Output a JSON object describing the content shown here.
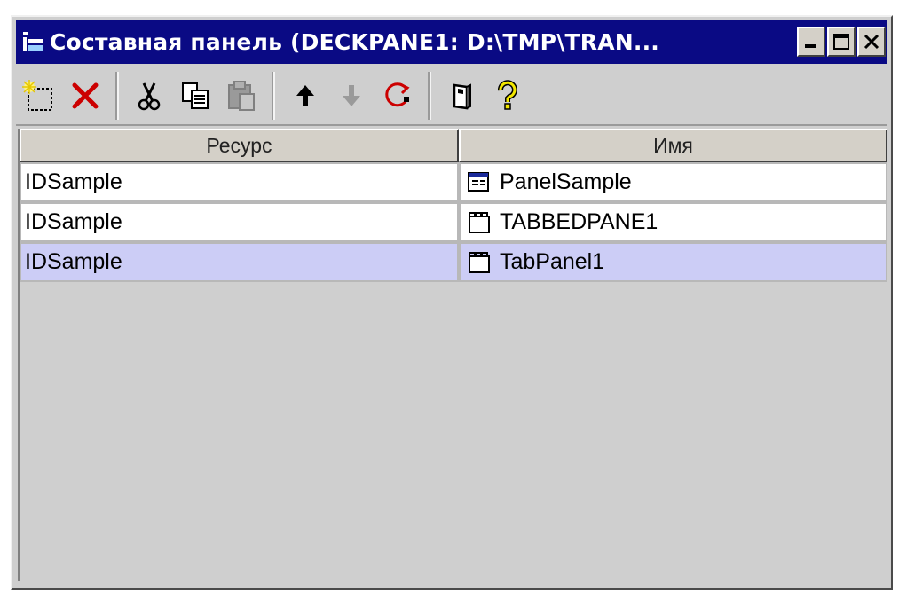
{
  "window": {
    "title": "Составная панель (DECKPANE1: D:\\TMP\\TRAN...",
    "icon": "panel-window-icon",
    "controls": [
      "minimize-icon",
      "maximize-icon",
      "close-icon"
    ]
  },
  "toolbar": {
    "buttons": [
      {
        "name": "new-icon"
      },
      {
        "name": "delete-icon",
        "color": "#cc0000"
      },
      {
        "name": "cut-icon"
      },
      {
        "name": "copy-icon"
      },
      {
        "name": "paste-icon",
        "disabled": true
      },
      {
        "name": "move-up-icon"
      },
      {
        "name": "move-down-icon",
        "disabled": true
      },
      {
        "name": "refresh-icon",
        "color": "#cc0000"
      },
      {
        "name": "properties-icon"
      },
      {
        "name": "help-icon",
        "color": "#e8d800"
      }
    ]
  },
  "table": {
    "columns": [
      "Ресурс",
      "Имя"
    ],
    "rows": [
      {
        "resource": "IDSample",
        "name": "PanelSample",
        "icon": "panel-icon",
        "selected": false
      },
      {
        "resource": "IDSample",
        "name": "TABBEDPANE1",
        "icon": "tabbed-pane-icon",
        "selected": false
      },
      {
        "resource": "IDSample",
        "name": "TabPanel1",
        "icon": "tab-panel-icon",
        "selected": true
      }
    ],
    "selection_color": "#cccdf6"
  }
}
